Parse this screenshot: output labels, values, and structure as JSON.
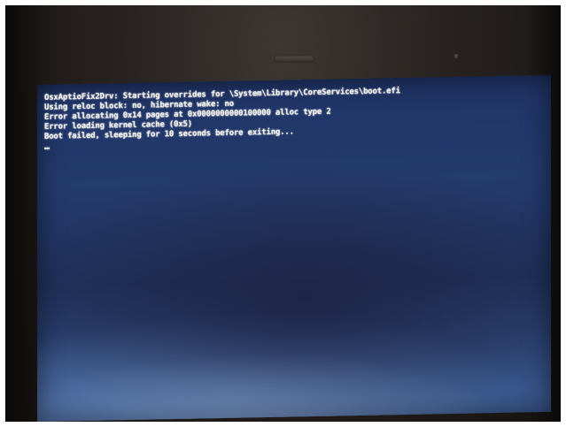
{
  "console": {
    "lines": [
      "OsxAptioFix2Drv: Starting overrides for \\System\\Library\\CoreServices\\boot.efi",
      "Using reloc block: no, hibernate wake: no",
      "Error allocating 0x14 pages at 0x0000000000100000 alloc type 2",
      "Error loading kernel cache (0x5)",
      "Boot failed, sleeping for 10 seconds before exiting..."
    ],
    "cursor": "_"
  },
  "colors": {
    "screen_background": "#243b6e",
    "console_text": "#f3f1ec",
    "bezel": "#26211e"
  },
  "icons": {
    "camera": "webcam-slot-icon",
    "sensor": "ambient-light-sensor-icon"
  }
}
